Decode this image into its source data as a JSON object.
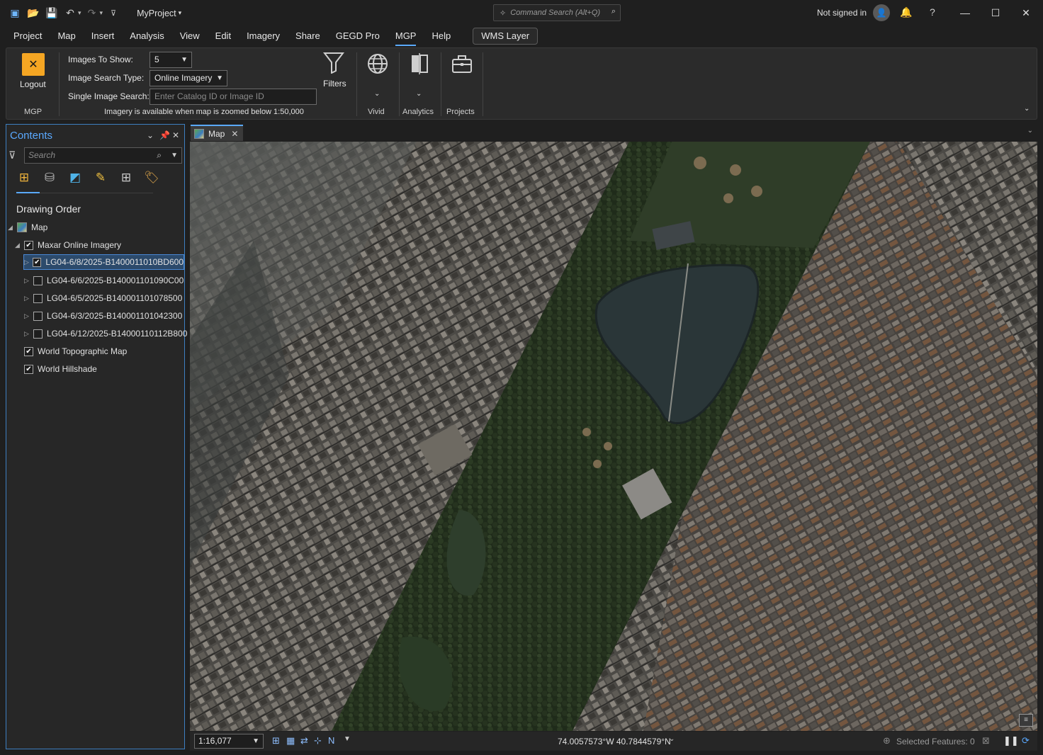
{
  "titlebar": {
    "project_name": "MyProject",
    "command_search_placeholder": "Command Search (Alt+Q)",
    "signed_in_text": "Not signed in"
  },
  "menu": {
    "tabs": [
      "Project",
      "Map",
      "Insert",
      "Analysis",
      "View",
      "Edit",
      "Imagery",
      "Share",
      "GEGD Pro",
      "MGP",
      "Help"
    ],
    "active_tab": "MGP",
    "contextual_button": "WMS Layer"
  },
  "ribbon": {
    "logout_label": "Logout",
    "mgp_group_label": "MGP",
    "images_to_show_label": "Images To Show:",
    "images_to_show_value": "5",
    "image_search_type_label": "Image Search Type:",
    "image_search_type_value": "Online Imagery",
    "single_image_search_label": "Single Image Search:",
    "single_image_search_placeholder": "Enter Catalog ID or Image ID",
    "notice": "Imagery is available when map is zoomed below 1:50,000",
    "filters_label": "Filters",
    "vivid_label": "Vivid",
    "analytics_label": "Analytics",
    "projects_label": "Projects"
  },
  "contents": {
    "title": "Contents",
    "search_placeholder": "Search",
    "section_title": "Drawing Order",
    "map_label": "Map",
    "group_layer": "Maxar Online Imagery",
    "image_layers": [
      {
        "name": "LG04-6/8/2025-B1400011010BD600",
        "checked": true
      },
      {
        "name": "LG04-6/6/2025-B140001101090C00",
        "checked": false
      },
      {
        "name": "LG04-6/5/2025-B140001101078500",
        "checked": false
      },
      {
        "name": "LG04-6/3/2025-B140001101042300",
        "checked": false
      },
      {
        "name": "LG04-6/12/2025-B14000110112B800",
        "checked": false
      }
    ],
    "basemaps": [
      {
        "name": "World Topographic Map",
        "checked": true
      },
      {
        "name": "World Hillshade",
        "checked": true
      }
    ]
  },
  "map_view": {
    "tab_label": "Map",
    "scale": "1:16,077",
    "coordinates": "74.0057573°W 40.7844579°N",
    "selected_features": "Selected Features: 0"
  },
  "colors": {
    "accent": "#5aa9ff",
    "logout_icon": "#f5a623",
    "panel_border": "#3d7fc1"
  }
}
